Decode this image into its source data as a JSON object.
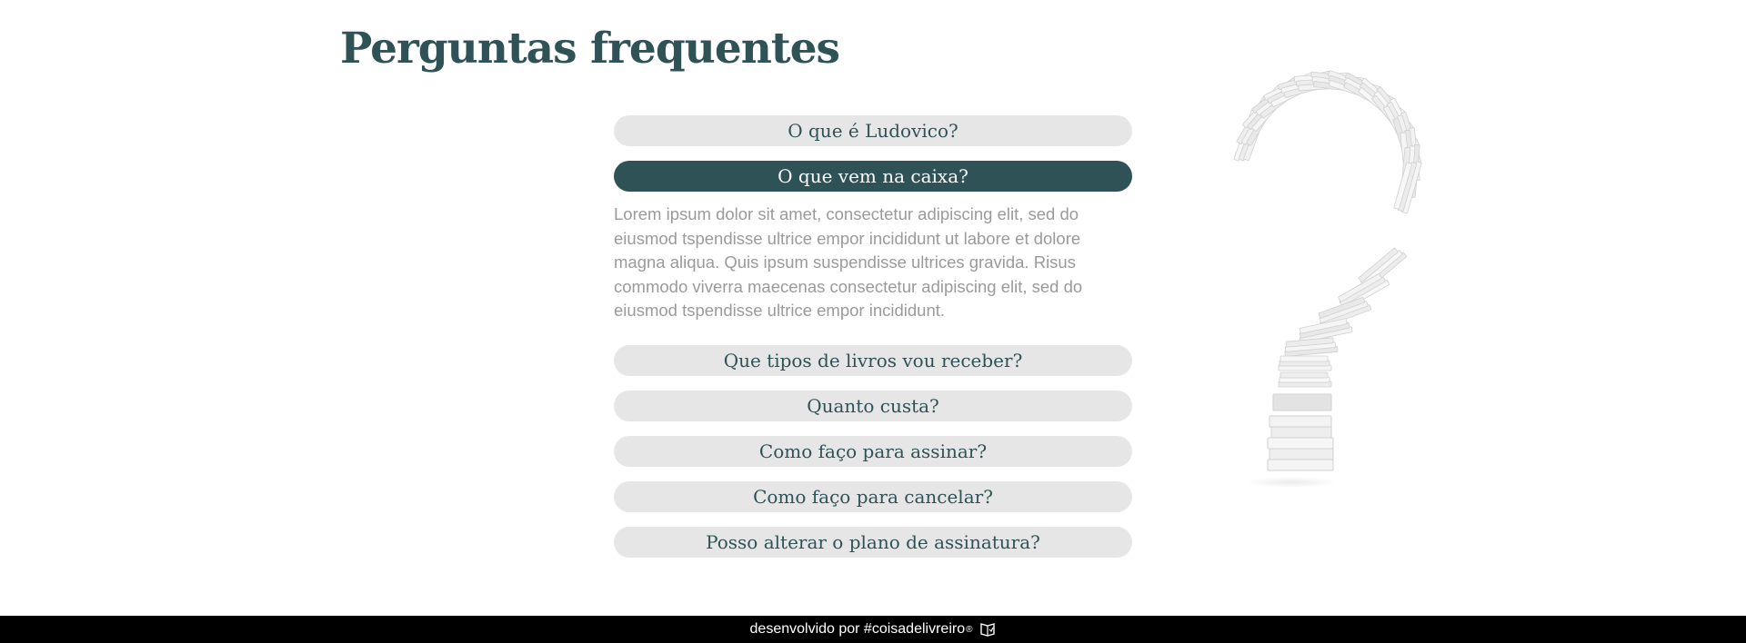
{
  "page": {
    "title": "Perguntas frequentes"
  },
  "faq": {
    "items": [
      {
        "question": "O que é Ludovico?",
        "answer": "",
        "open": false
      },
      {
        "question": "O que vem na caixa?",
        "answer": "Lorem ipsum dolor sit amet, consectetur adipiscing elit, sed do eiusmod tspendisse ultrice empor incididunt ut labore et dolore magna aliqua. Quis ipsum suspendisse ultrices gravida. Risus commodo viverra maecenas consectetur adipiscing elit, sed do eiusmod tspendisse ultrice empor incididunt.",
        "open": true
      },
      {
        "question": "Que tipos de livros vou receber?",
        "answer": "",
        "open": false
      },
      {
        "question": "Quanto custa?",
        "answer": "",
        "open": false
      },
      {
        "question": "Como faço para assinar?",
        "answer": "",
        "open": false
      },
      {
        "question": "Como faço para cancelar?",
        "answer": "",
        "open": false
      },
      {
        "question": "Posso alterar o plano de assinatura?",
        "answer": "",
        "open": false
      }
    ]
  },
  "footer": {
    "text": "desenvolvido por #coisadelivreiro",
    "mark": "®",
    "icon": "book-icon"
  },
  "colors": {
    "primary": "#2f5257",
    "pill": "#e6e6e6",
    "answer_text": "#9a9a9a",
    "footer_bg": "#000000"
  }
}
